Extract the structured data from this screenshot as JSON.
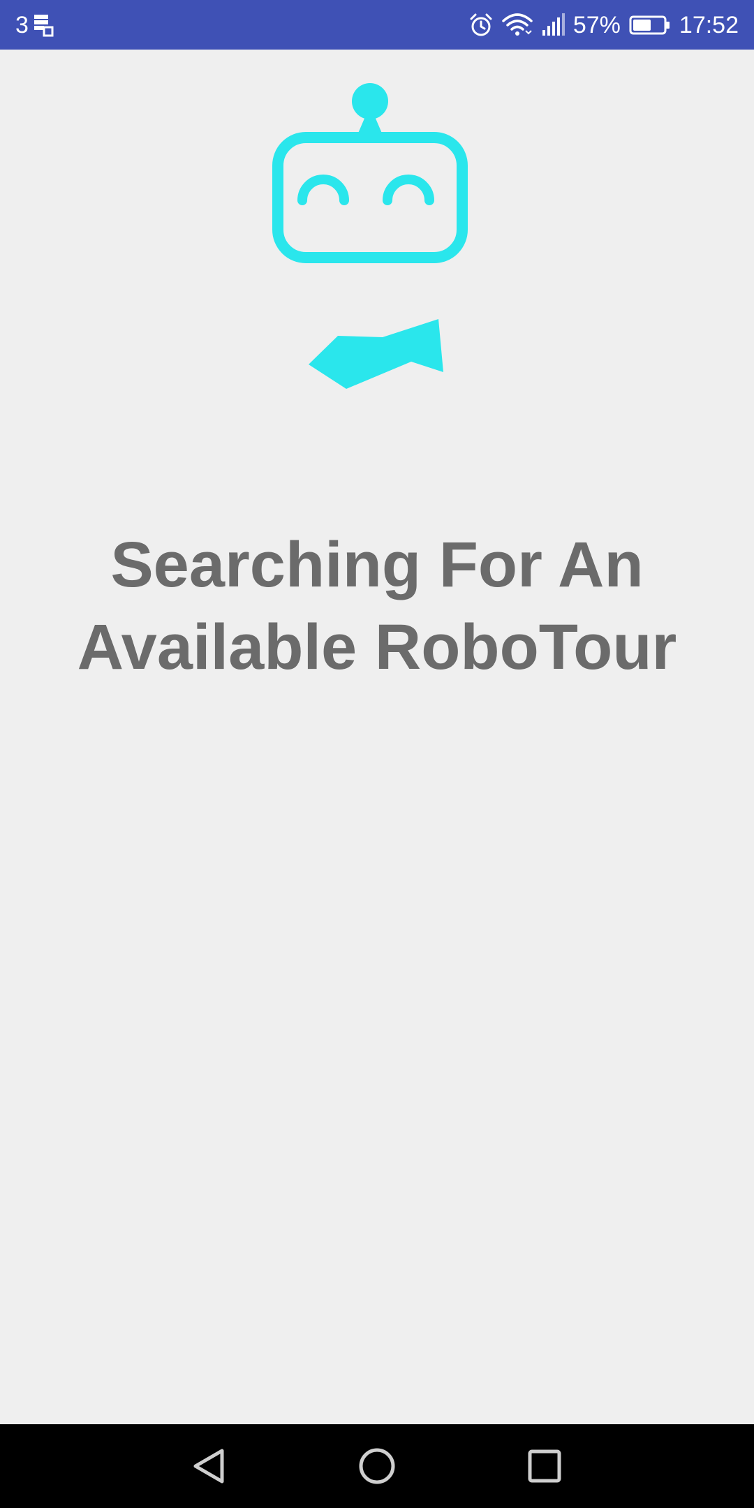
{
  "status_bar": {
    "notification_count": "3",
    "battery_percent": "57%",
    "time": "17:52",
    "icons": [
      "notification-stack-icon",
      "alarm-icon",
      "wifi-icon",
      "signal-icon",
      "battery-icon"
    ]
  },
  "logo": {
    "name": "robotour-robot-logo",
    "color": "#2ae6ec"
  },
  "main": {
    "title_line1": "Searching For An",
    "title_line2": "Available RoboTour"
  },
  "nav_bar": {
    "buttons": [
      "back-icon",
      "home-icon",
      "recents-icon"
    ]
  },
  "colors": {
    "status_bar": "#3f51b5",
    "background": "#efefef",
    "title_text": "#6b6b6b",
    "accent": "#2ae6ec",
    "nav_bar": "#000000"
  }
}
